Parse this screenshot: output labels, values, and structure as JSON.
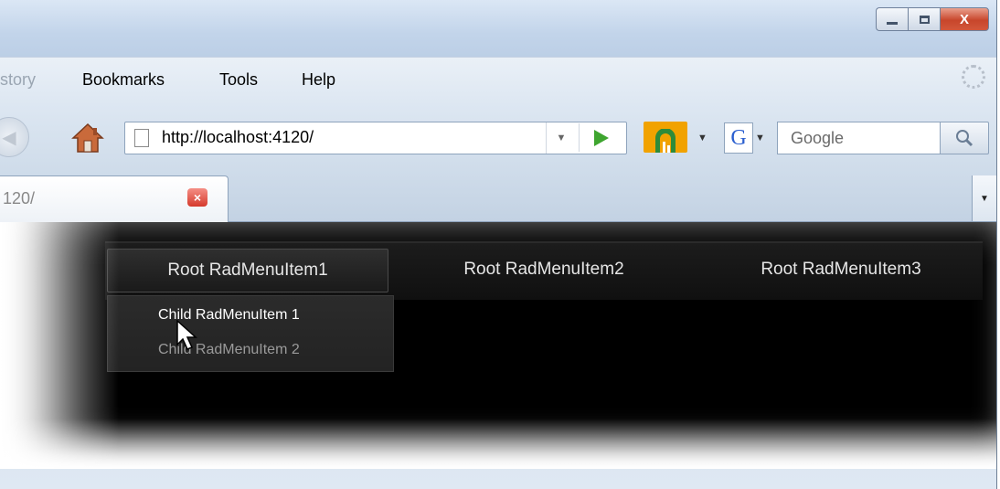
{
  "window": {
    "controls": [
      "minimize-icon",
      "maximize-icon",
      "close-icon"
    ],
    "close_label": "X"
  },
  "menubar": {
    "history": "story",
    "bookmarks": "Bookmarks",
    "tools": "Tools",
    "help": "Help"
  },
  "navbar": {
    "url": "http://localhost:4120/",
    "search_placeholder": "Google",
    "google_label": "G"
  },
  "tab": {
    "label": "120/",
    "close_label": "×"
  },
  "radmenu": {
    "root_items": [
      "Root RadMenuItem1",
      "Root RadMenuItem2",
      "Root RadMenuItem3"
    ],
    "child_items": [
      "Child RadMenuItem 1",
      "Child RadMenuItem 2"
    ]
  },
  "colors": {
    "menu_bg": "#101010",
    "menu_text": "#e6e6e6",
    "child_disabled": "#9a9a9a",
    "go_arrow": "#3ea52f",
    "addon_orange": "#f1a200"
  }
}
